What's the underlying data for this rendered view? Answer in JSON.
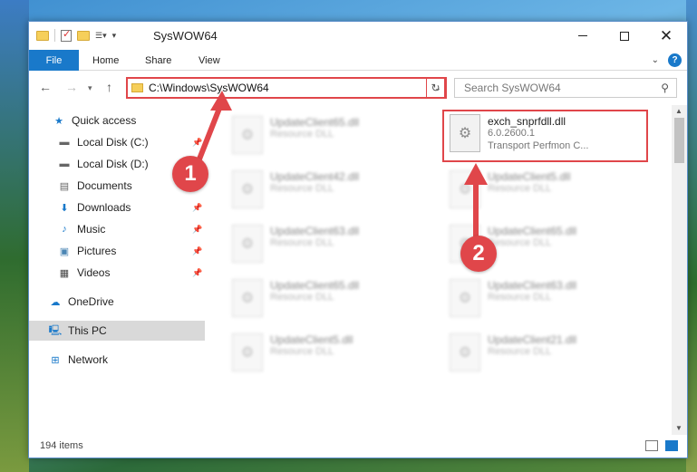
{
  "window": {
    "title": "SysWOW64",
    "controls": {
      "minimize": "—",
      "maximize": "",
      "close": "✕"
    }
  },
  "ribbon": {
    "file": "File",
    "tabs": [
      "Home",
      "Share",
      "View"
    ],
    "help": "?"
  },
  "nav": {
    "address": "C:\\Windows\\SysWOW64",
    "search_placeholder": "Search SysWOW64"
  },
  "sidebar": {
    "items": [
      {
        "label": "Quick access",
        "icon": "star-icon"
      },
      {
        "label": "Local Disk (C:)",
        "icon": "drive-icon"
      },
      {
        "label": "Local Disk (D:)",
        "icon": "drive-icon"
      },
      {
        "label": "Documents",
        "icon": "documents-icon"
      },
      {
        "label": "Downloads",
        "icon": "download-icon"
      },
      {
        "label": "Music",
        "icon": "music-icon"
      },
      {
        "label": "Pictures",
        "icon": "pictures-icon"
      },
      {
        "label": "Videos",
        "icon": "videos-icon"
      },
      {
        "label": "OneDrive",
        "icon": "cloud-icon"
      },
      {
        "label": "This PC",
        "icon": "computer-icon"
      },
      {
        "label": "Network",
        "icon": "network-icon"
      }
    ]
  },
  "files": {
    "highlighted": {
      "name": "exch_snprfdll.dll",
      "version": "6.0.2600.1",
      "description": "Transport Perfmon C..."
    },
    "blurred": [
      {
        "name": "UpdateClient65.dll",
        "type": "Resource DLL"
      },
      {
        "name": "UpdateClient42.dll",
        "type": "Resource DLL"
      },
      {
        "name": "UpdateClient5.dll",
        "type": "Resource DLL"
      },
      {
        "name": "UpdateClient63.dll",
        "type": "Resource DLL"
      },
      {
        "name": "UpdateClient65.dll",
        "type": "Resource DLL"
      },
      {
        "name": "UpdateClient65.dll",
        "type": "Resource DLL"
      },
      {
        "name": "UpdateClient63.dll",
        "type": "Resource DLL"
      },
      {
        "name": "UpdateClient5.dll",
        "type": "Resource DLL"
      },
      {
        "name": "UpdateClient21.dll",
        "type": "Resource DLL"
      }
    ]
  },
  "status": {
    "count": "194 items"
  },
  "annotations": {
    "step1": "1",
    "step2": "2"
  },
  "colors": {
    "accent": "#1979ca",
    "highlight": "#e0464a"
  }
}
